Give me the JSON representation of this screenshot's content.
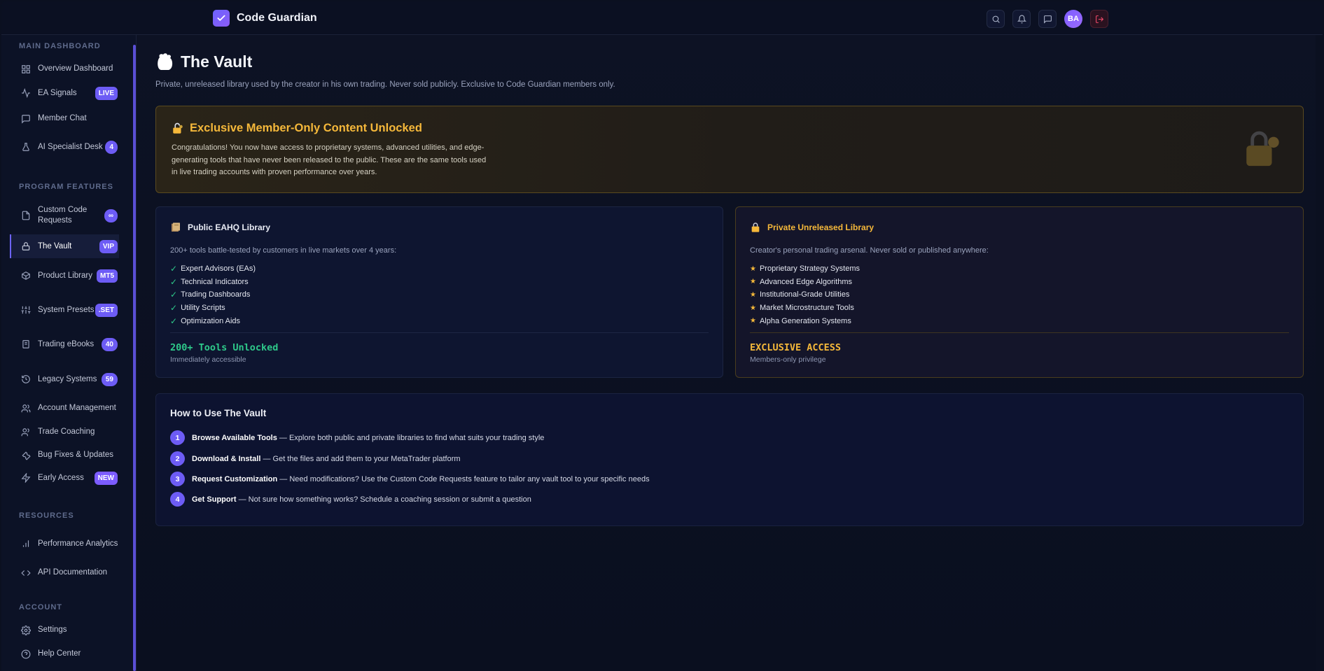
{
  "app": {
    "name": "Code Guardian"
  },
  "header": {
    "avatar_initials": "BA"
  },
  "colors": {
    "accent": "#6d5cf5",
    "gold": "#f5b83a",
    "green": "#2ec98a"
  },
  "sidebar": {
    "sections": {
      "main": "MAIN DASHBOARD",
      "program": "PROGRAM FEATURES",
      "resources": "RESOURCES",
      "account": "ACCOUNT"
    },
    "items": [
      {
        "label": "Overview Dashboard",
        "icon": "grid-icon"
      },
      {
        "label": "EA Signals",
        "icon": "activity-icon",
        "badge": "LIVE"
      },
      {
        "label": "Member Chat",
        "icon": "chat-icon"
      },
      {
        "label": "AI Specialist Desk",
        "icon": "flask-icon",
        "badge": "4"
      },
      {
        "label": "Custom Code Requests",
        "icon": "file-icon",
        "badge": "∞"
      },
      {
        "label": "The Vault",
        "icon": "lock-icon",
        "badge": "VIP"
      },
      {
        "label": "Product Library",
        "icon": "box-icon",
        "badge": "MT5"
      },
      {
        "label": "System Presets",
        "icon": "sliders-icon",
        "badge": ".SET"
      },
      {
        "label": "Trading eBooks",
        "icon": "book-icon",
        "badge": "40"
      },
      {
        "label": "Legacy Systems",
        "icon": "history-icon",
        "badge": "59"
      },
      {
        "label": "Account Management",
        "icon": "users-icon"
      },
      {
        "label": "Trade Coaching",
        "icon": "users-icon"
      },
      {
        "label": "Bug Fixes & Updates",
        "icon": "wrench-icon"
      },
      {
        "label": "Early Access",
        "icon": "bolt-icon",
        "badge": "NEW"
      },
      {
        "label": "Performance Analytics",
        "icon": "bar-chart-icon"
      },
      {
        "label": "API Documentation",
        "icon": "code-icon"
      },
      {
        "label": "Settings",
        "icon": "gear-icon"
      },
      {
        "label": "Help Center",
        "icon": "help-icon"
      }
    ]
  },
  "page": {
    "title": "The Vault",
    "subtitle": "Private, unreleased library used by the creator in his own trading. Never sold publicly. Exclusive to Code Guardian members only."
  },
  "unlock": {
    "title": "Exclusive Member-Only Content Unlocked",
    "text": "Congratulations! You now have access to proprietary systems, advanced utilities, and edge-generating tools that have never been released to the public. These are the same tools used in live trading accounts with proven performance over years."
  },
  "public_library": {
    "title": "Public EAHQ Library",
    "desc": "200+ tools battle-tested by customers in live markets over 4 years:",
    "check_glyph": "✓",
    "items": [
      "Expert Advisors (EAs)",
      "Technical Indicators",
      "Trading Dashboards",
      "Utility Scripts",
      "Optimization Aids"
    ],
    "stat": "200+ Tools Unlocked",
    "note": "Immediately accessible"
  },
  "private_library": {
    "title": "Private Unreleased Library",
    "desc": "Creator's personal trading arsenal. Never sold or published anywhere:",
    "star_glyph": "★",
    "items": [
      "Proprietary Strategy Systems",
      "Advanced Edge Algorithms",
      "Institutional-Grade Utilities",
      "Market Microstructure Tools",
      "Alpha Generation Systems"
    ],
    "stat": "EXCLUSIVE ACCESS",
    "note": "Members-only privilege"
  },
  "howto": {
    "title": "How to Use The Vault",
    "steps": [
      {
        "num": "1",
        "bold": "Browse Available Tools",
        "text": " — Explore both public and private libraries to find what suits your trading style"
      },
      {
        "num": "2",
        "bold": "Download & Install",
        "text": " — Get the files and add them to your MetaTrader platform"
      },
      {
        "num": "3",
        "bold": "Request Customization",
        "text": " — Need modifications? Use the Custom Code Requests feature to tailor any vault tool to your specific needs"
      },
      {
        "num": "4",
        "bold": "Get Support",
        "text": " — Not sure how something works? Schedule a coaching session or submit a question"
      }
    ]
  }
}
